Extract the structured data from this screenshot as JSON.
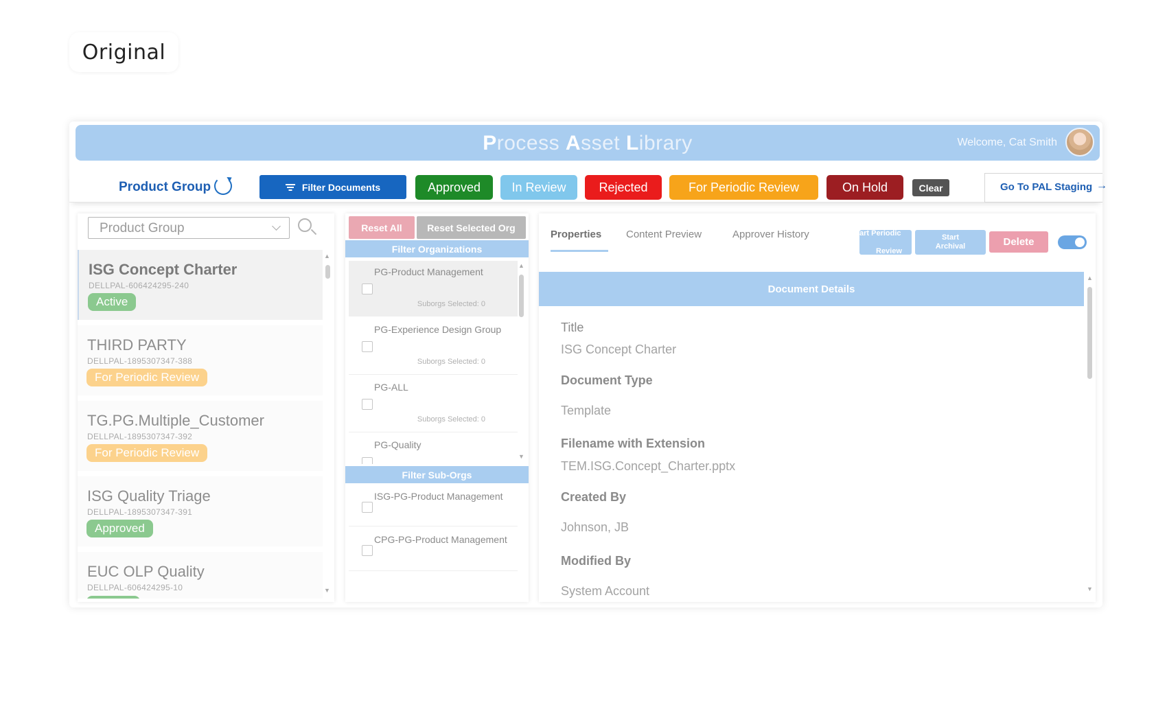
{
  "page_label": "Original",
  "header": {
    "title_parts": [
      {
        "initial": "P",
        "rest": "rocess "
      },
      {
        "initial": "A",
        "rest": "sset "
      },
      {
        "initial": "L",
        "rest": "ibrary"
      }
    ],
    "welcome": "Welcome, Cat Smith"
  },
  "toolbar": {
    "product_group": "Product Group",
    "filter_documents": "Filter Documents",
    "status_filters": {
      "approved": "Approved",
      "in_review": "In Review",
      "rejected": "Rejected",
      "periodic": "For Periodic Review",
      "on_hold": "On Hold"
    },
    "clear": "Clear",
    "staging": "Go To PAL Staging"
  },
  "left_panel": {
    "select_placeholder": "Product Group",
    "documents": [
      {
        "title": "ISG Concept Charter",
        "id": "DELLPAL-606424295-240",
        "status": "Active"
      },
      {
        "title": "THIRD PARTY",
        "id": "DELLPAL-1895307347-388",
        "status": "For Periodic Review"
      },
      {
        "title": "TG.PG.Multiple_Customer",
        "id": "DELLPAL-1895307347-392",
        "status": "For Periodic Review"
      },
      {
        "title": "ISG Quality Triage",
        "id": "DELLPAL-1895307347-391",
        "status": "Approved"
      },
      {
        "title": "EUC OLP Quality",
        "id": "DELLPAL-606424295-10",
        "status": ""
      }
    ]
  },
  "middle_panel": {
    "reset_all": "Reset All",
    "reset_selected_org": "Reset Selected Org",
    "filter_organizations": "Filter Organizations",
    "organizations": [
      {
        "name": "PG-Product Management",
        "suborgs": "Suborgs Selected: 0"
      },
      {
        "name": "PG-Experience Design Group",
        "suborgs": "Suborgs Selected: 0"
      },
      {
        "name": "PG-ALL",
        "suborgs": "Suborgs Selected: 0"
      },
      {
        "name": "PG-Quality",
        "suborgs": ""
      }
    ],
    "filter_suborgs": "Filter Sub-Orgs",
    "suborgs": [
      {
        "name": "ISG-PG-Product Management"
      },
      {
        "name": "CPG-PG-Product Management"
      }
    ]
  },
  "right_panel": {
    "tabs": {
      "properties": "Properties",
      "content_preview": "Content Preview",
      "approver_history": "Approver History"
    },
    "actions": {
      "periodic_line1": "art Periodic",
      "periodic_line2": "Review",
      "archival_line1": "Start",
      "archival_line2": "Archival",
      "delete": "Delete"
    },
    "details_title": "Document Details",
    "fields": [
      {
        "label": "Title",
        "value": "ISG Concept Charter"
      },
      {
        "label": "Document Type",
        "value": "Template"
      },
      {
        "label": "Filename with Extension",
        "value": "TEM.ISG.Concept_Charter.pptx"
      },
      {
        "label": "Created By",
        "value": "Johnson, JB"
      },
      {
        "label": "Modified By",
        "value": "System Account"
      }
    ]
  },
  "colors": {
    "header_blue": "#a9cdf0",
    "primary_blue": "#1766c0",
    "approved_green": "#1e8a28",
    "in_review": "#80c7ec",
    "rejected_red": "#ea1c1c",
    "periodic_orange": "#f7a41a",
    "on_hold": "#9c1e22"
  }
}
